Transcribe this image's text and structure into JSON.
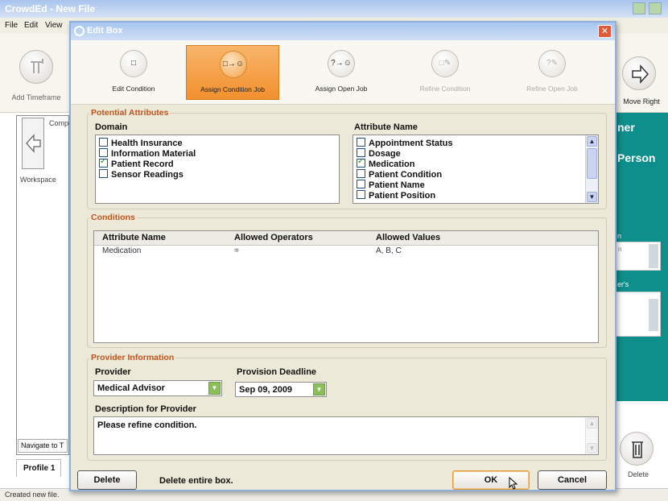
{
  "app": {
    "title": "CrowdEd - New File",
    "menu": [
      "File",
      "Edit",
      "View"
    ],
    "toolbar": {
      "add_timeframe": "Add Timeframe",
      "move_right": "Move Right",
      "delete": "Delete"
    },
    "left_pane": {
      "header": "Compo",
      "workspace": "Workspace",
      "nav": "Navigate to T"
    },
    "profile_tab": "Profile 1",
    "status": "Created new file.",
    "right_pane": {
      "text1": "ner",
      "text2": "Person",
      "text3": "n",
      "text4": "er's",
      "field_hint": "n"
    }
  },
  "dialog": {
    "title": "Edit Box",
    "steps": [
      {
        "label": "Edit Condition",
        "glyph": "□",
        "state": "normal"
      },
      {
        "label": "Assign Condition Job",
        "glyph": "□→☺",
        "state": "active"
      },
      {
        "label": "Assign Open Job",
        "glyph": "?→☺",
        "state": "normal"
      },
      {
        "label": "Refine Condition",
        "glyph": "□✎",
        "state": "disabled"
      },
      {
        "label": "Refine Open Job",
        "glyph": "?✎",
        "state": "disabled"
      }
    ],
    "potential_attributes": {
      "legend": "Potential Attributes",
      "domain_label": "Domain",
      "domains": [
        {
          "label": "Health Insurance",
          "checked": false
        },
        {
          "label": "Information Material",
          "checked": false
        },
        {
          "label": "Patient Record",
          "checked": true
        },
        {
          "label": "Sensor Readings",
          "checked": false
        }
      ],
      "attribute_label": "Attribute Name",
      "attributes": [
        {
          "label": "Appointment Status",
          "checked": false
        },
        {
          "label": "Dosage",
          "checked": false
        },
        {
          "label": "Medication",
          "checked": true
        },
        {
          "label": "Patient Condition",
          "checked": false
        },
        {
          "label": "Patient Name",
          "checked": false
        },
        {
          "label": "Patient Position",
          "checked": false
        }
      ]
    },
    "conditions": {
      "legend": "Conditions",
      "columns": [
        "Attribute Name",
        "Allowed Operators",
        "Allowed Values"
      ],
      "rows": [
        [
          "Medication",
          "=",
          "A, B, C"
        ]
      ]
    },
    "provider": {
      "legend": "Provider Information",
      "provider_label": "Provider",
      "provider_value": "Medical Advisor",
      "deadline_label": "Provision Deadline",
      "deadline_value": "Sep 09, 2009",
      "description_label": "Description for Provider",
      "description_value": "Please refine condition."
    },
    "footer": {
      "delete_label": "Delete",
      "delete_hint": "Delete entire box.",
      "ok_label": "OK",
      "cancel_label": "Cancel"
    }
  },
  "colors": {
    "accent_orange": "#f2902e",
    "legend_text": "#c0541c",
    "teal_panel": "#0f8f8c",
    "check_green": "#1c8a1c",
    "combo_button": "#8bbf5a"
  }
}
